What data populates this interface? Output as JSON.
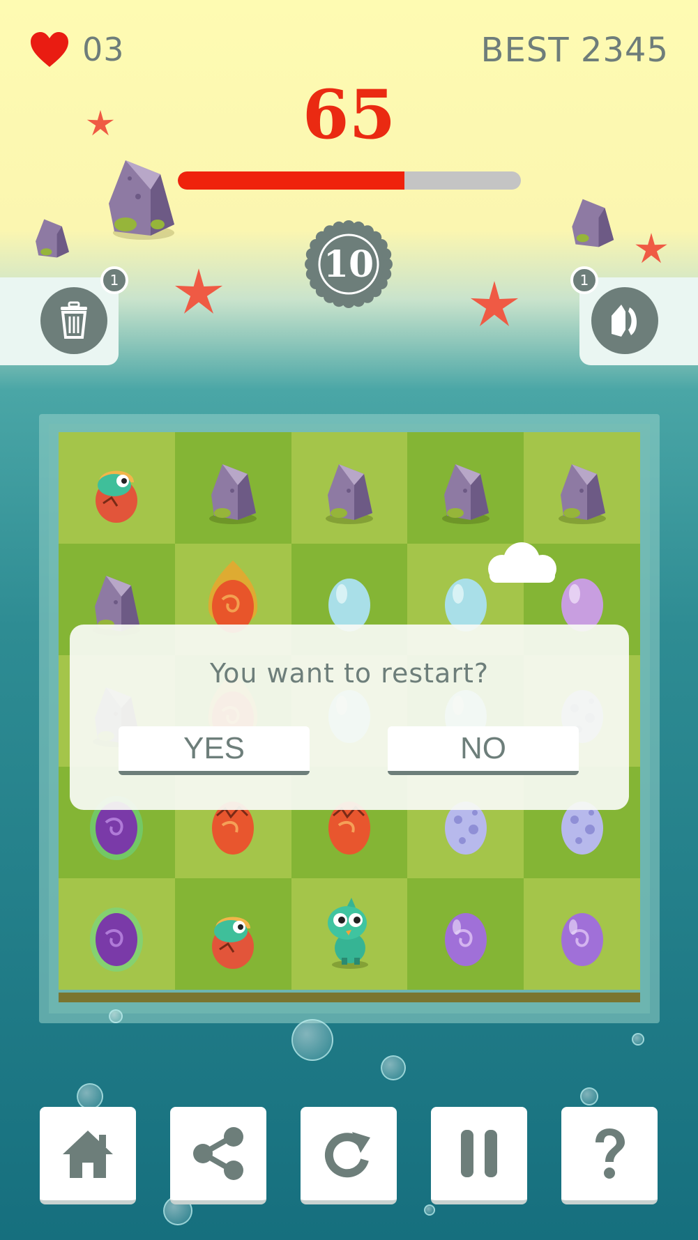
{
  "hud": {
    "lives": "03",
    "best": "BEST 2345",
    "score": "65",
    "level": "10",
    "progress_fraction": 0.66
  },
  "powerups": {
    "trash": {
      "icon": "trash-icon",
      "count": "1"
    },
    "swap": {
      "icon": "swap-icon",
      "count": "1"
    }
  },
  "board": {
    "rows": [
      [
        "dino-egg",
        "rock",
        "rock",
        "rock",
        "rock"
      ],
      [
        "rock",
        "fire-egg",
        "blue-egg",
        "blue-egg",
        "purple-egg"
      ],
      [
        "rock",
        "fire-egg",
        "blue-egg",
        "blue-egg",
        "spotted-egg"
      ],
      [
        "glow-egg",
        "cracked-egg",
        "cracked-egg",
        "spotted-egg",
        "spotted-egg"
      ],
      [
        "glow-egg",
        "dino-egg",
        "baby-dino",
        "swirl-egg",
        "swirl-egg"
      ]
    ]
  },
  "dialog": {
    "question": "You want to restart?",
    "yes": "YES",
    "no": "NO"
  },
  "toolbar": [
    {
      "name": "home",
      "icon": "home-icon"
    },
    {
      "name": "share",
      "icon": "share-icon"
    },
    {
      "name": "restart",
      "icon": "refresh-icon"
    },
    {
      "name": "pause",
      "icon": "pause-icon"
    },
    {
      "name": "help",
      "icon": "question-icon"
    }
  ],
  "colors": {
    "score_red": "#ea2a12",
    "ui_gray": "#6d7e7a",
    "progress_red": "#ef220c",
    "progress_track": "#c4c4c4",
    "grass_light": "#a4c54a",
    "grass_dark": "#84b535"
  }
}
